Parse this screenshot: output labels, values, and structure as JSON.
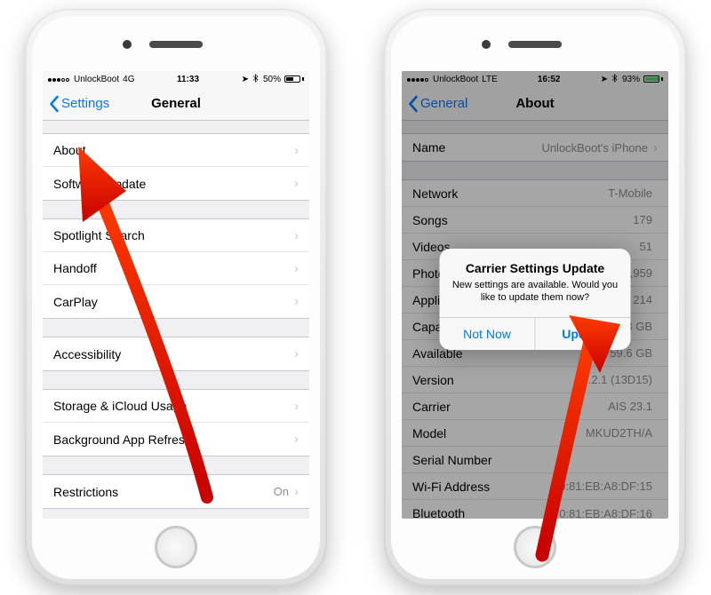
{
  "left": {
    "status": {
      "carrier": "UnlockBoot",
      "net": "4G",
      "time": "11:33",
      "bt_icon": "bluetooth-icon",
      "batt_pct": "50%",
      "batt_fill": 50
    },
    "nav": {
      "back_label": "Settings",
      "title": "General"
    },
    "groups": [
      [
        {
          "label": "About"
        },
        {
          "label": "Software Update"
        }
      ],
      [
        {
          "label": "Spotlight Search"
        },
        {
          "label": "Handoff"
        },
        {
          "label": "CarPlay"
        }
      ],
      [
        {
          "label": "Accessibility"
        }
      ],
      [
        {
          "label": "Storage & iCloud Usage"
        },
        {
          "label": "Background App Refresh"
        }
      ],
      [
        {
          "label": "Restrictions",
          "value": "On"
        }
      ]
    ]
  },
  "right": {
    "status": {
      "carrier": "UnlockBoot",
      "net": "LTE",
      "time": "16:52",
      "bt_icon": "bluetooth-icon",
      "batt_pct": "93%",
      "batt_fill": 93
    },
    "nav": {
      "back_label": "General",
      "title": "About"
    },
    "rows": [
      {
        "label": "Name",
        "value": "UnlockBoot's iPhone",
        "chev": true
      },
      {
        "gap": true
      },
      {
        "label": "Network",
        "value": "T-Mobile"
      },
      {
        "label": "Songs",
        "value": "179"
      },
      {
        "label": "Videos",
        "value": "51"
      },
      {
        "label": "Photos",
        "value": "3,959"
      },
      {
        "label": "Applications",
        "value": "214"
      },
      {
        "label": "Capacity",
        "value": "113 GB"
      },
      {
        "label": "Available",
        "value": "59.6 GB"
      },
      {
        "label": "Version",
        "value": "10.2.1 (13D15)"
      },
      {
        "label": "Carrier",
        "value": "AIS 23.1"
      },
      {
        "label": "Model",
        "value": "MKUD2TH/A"
      },
      {
        "label": "Serial Number",
        "value": ""
      },
      {
        "label": "Wi-Fi Address",
        "value": "70:81:EB:A8:DF:15"
      },
      {
        "label": "Bluetooth",
        "value": "70:81:EB:A8:DF:16"
      }
    ],
    "alert": {
      "title": "Carrier Settings Update",
      "message": "New settings are available. Would you like to update them now?",
      "not_now": "Not Now",
      "update": "Update"
    }
  }
}
